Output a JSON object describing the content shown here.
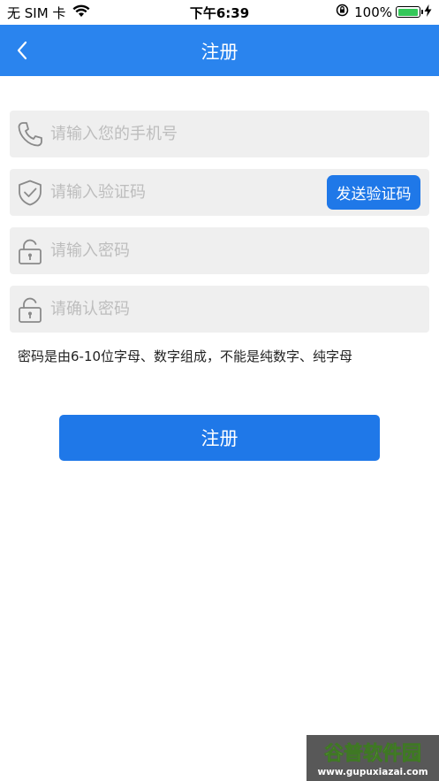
{
  "status_bar": {
    "carrier": "无 SIM 卡",
    "time": "下午6:39",
    "battery_percent": "100%",
    "battery_level": 1.0,
    "icons": [
      "wifi-icon",
      "orientation-lock-icon",
      "battery-icon",
      "charging-icon"
    ]
  },
  "nav": {
    "title": "注册",
    "back_icon": "chevron-left-icon"
  },
  "form": {
    "phone": {
      "placeholder": "请输入您的手机号",
      "value": "",
      "icon": "phone-icon"
    },
    "code": {
      "placeholder": "请输入验证码",
      "value": "",
      "icon": "shield-check-icon",
      "send_label": "发送验证码"
    },
    "password": {
      "placeholder": "请输入密码",
      "value": "",
      "icon": "lock-icon"
    },
    "confirm": {
      "placeholder": "请确认密码",
      "value": "",
      "icon": "lock-icon"
    },
    "hint": "密码是由6-10位字母、数字组成，不能是纯数字、纯字母",
    "submit_label": "注册"
  },
  "watermark": {
    "brand": "谷普软件园",
    "url": "www.gupuxiazai.com"
  },
  "colors": {
    "primary": "#2a84ee",
    "button": "#1f78e8",
    "field_bg": "#efefef",
    "placeholder": "#bdbdbd",
    "battery": "#34c759"
  }
}
